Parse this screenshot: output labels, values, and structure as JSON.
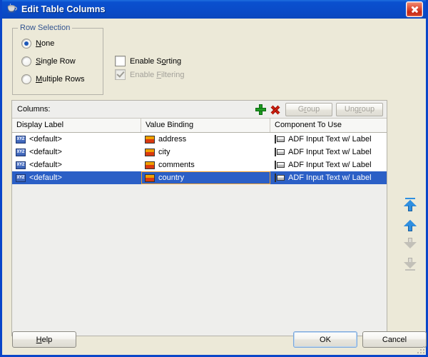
{
  "window": {
    "title": "Edit Table Columns",
    "icon": "java-coffee-cup-icon",
    "close_label": "Close"
  },
  "row_selection": {
    "legend": "Row Selection",
    "options": [
      {
        "label": "None",
        "mnemonic": "N",
        "selected": true
      },
      {
        "label": "Single Row",
        "mnemonic": "S",
        "selected": false
      },
      {
        "label": "Multiple Rows",
        "mnemonic": "M",
        "selected": false
      }
    ]
  },
  "options": {
    "enable_sorting": {
      "label": "Enable Sorting",
      "mnemonic": "o",
      "checked": false,
      "disabled": false
    },
    "enable_filtering": {
      "label": "Enable Filtering",
      "mnemonic": "F",
      "checked": true,
      "disabled": true
    }
  },
  "columns_panel": {
    "label": "Columns:",
    "add_icon": "green-plus-icon",
    "delete_icon": "red-x-icon",
    "group_button": "Group",
    "ungroup_button": "Ungroup",
    "headers": [
      "Display Label",
      "Value Binding",
      "Component To Use"
    ],
    "rows": [
      {
        "display_label": "<default>",
        "value_binding": "address",
        "component": "ADF Input Text w/ Label",
        "selected": false
      },
      {
        "display_label": "<default>",
        "value_binding": "city",
        "component": "ADF Input Text w/ Label",
        "selected": false
      },
      {
        "display_label": "<default>",
        "value_binding": "comments",
        "component": "ADF Input Text w/ Label",
        "selected": false
      },
      {
        "display_label": "<default>",
        "value_binding": "country",
        "component": "ADF Input Text w/ Label",
        "selected": true
      }
    ],
    "row_icons": {
      "display_label": "xyz-text-icon",
      "value_binding": "attribute-icon",
      "component": "input-text-label-icon"
    }
  },
  "move_buttons": [
    {
      "name": "move-to-top",
      "enabled": true
    },
    {
      "name": "move-up",
      "enabled": true
    },
    {
      "name": "move-down",
      "enabled": false
    },
    {
      "name": "move-to-bottom",
      "enabled": false
    }
  ],
  "footer": {
    "help": "Help",
    "help_mnemonic": "H",
    "ok": "OK",
    "cancel": "Cancel"
  },
  "colors": {
    "titlebar": "#0a4bc8",
    "selection": "#2b5fc6",
    "focus_cell_border": "#f0a030",
    "legend_text": "#31538f",
    "dialog_bg": "#ece9d8"
  }
}
